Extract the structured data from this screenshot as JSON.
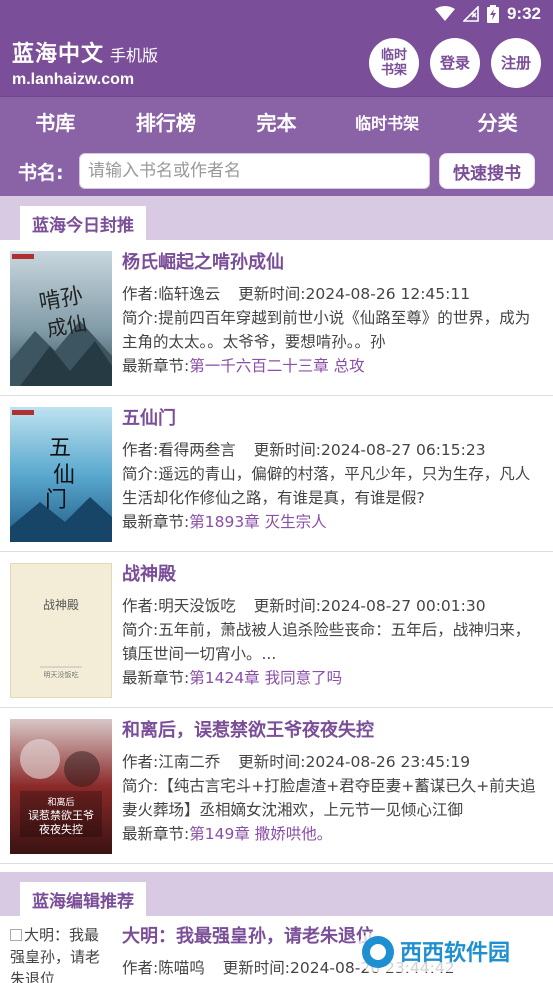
{
  "status": {
    "time": "9:32"
  },
  "header": {
    "site_name": "蓝海中文",
    "site_sub": "手机版",
    "url": "m.lanhaizw.com",
    "buttons": {
      "temp_shelf": "临时书架",
      "login": "登录",
      "register": "注册"
    }
  },
  "nav": [
    "书库",
    "排行榜",
    "完本",
    "临时书架",
    "分类"
  ],
  "search": {
    "label": "书名:",
    "placeholder": "请输入书名或作者名",
    "button": "快速搜书"
  },
  "sections": {
    "today": "蓝海今日封推",
    "editor": "蓝海编辑推荐"
  },
  "labels": {
    "author": "作者:",
    "update": "更新时间:",
    "intro": "简介:",
    "latest": "最新章节:"
  },
  "books": [
    {
      "title": "杨氏崛起之啃孙成仙",
      "author": "临轩逸云",
      "update": "2024-08-26 12:45:11",
      "intro": "提前四百年穿越到前世小说《仙路至尊》的世界，成为主角的太太。。太爷爷，要想啃孙。。孙",
      "latest": "第一千六百二十三章 总攻",
      "cover_text": "啃孙成仙"
    },
    {
      "title": "五仙门",
      "author": "看得两叁言",
      "update": "2024-08-27 06:15:23",
      "intro": "遥远的青山，偏僻的村落，平凡少年，只为生存，凡人生活却化作修仙之路，有谁是真，有谁是假?",
      "latest": "第1893章 灭生宗人",
      "cover_text": "五仙门"
    },
    {
      "title": "战神殿",
      "author": "明天没饭吃",
      "update": "2024-08-27 00:01:30",
      "intro": "五年前，萧战被人追杀险些丧命：五年后，战神归来，镇压世间一切宵小。...",
      "latest": "第1424章 我同意了吗",
      "cover_text": "战神殿",
      "cover_sub": "明天没饭吃"
    },
    {
      "title": "和离后，误惹禁欲王爷夜夜失控",
      "author": "江南二乔",
      "update": "2024-08-26 23:45:19",
      "intro": "【纯古言宅斗+打脸虐渣+君夺臣妻+蓄谋已久+前夫追妻火葬场】丞相嫡女沈湘欢，上元节一见倾心江御",
      "latest": "第149章 撒娇哄他。",
      "cover_text": "和离后 误惹禁欲王爷 夜夜失控"
    }
  ],
  "partial_book": {
    "img_alt": "大明：我最强皇孙，请老朱退位",
    "title": "大明：我最强皇孙，请老朱退位",
    "author": "陈喵呜",
    "update": "2024-08-26 23:44:42"
  },
  "watermark": "西西软件园",
  "colors": {
    "primary": "#7a4e98",
    "nav": "#8a62a6",
    "section": "#d9cae4"
  }
}
